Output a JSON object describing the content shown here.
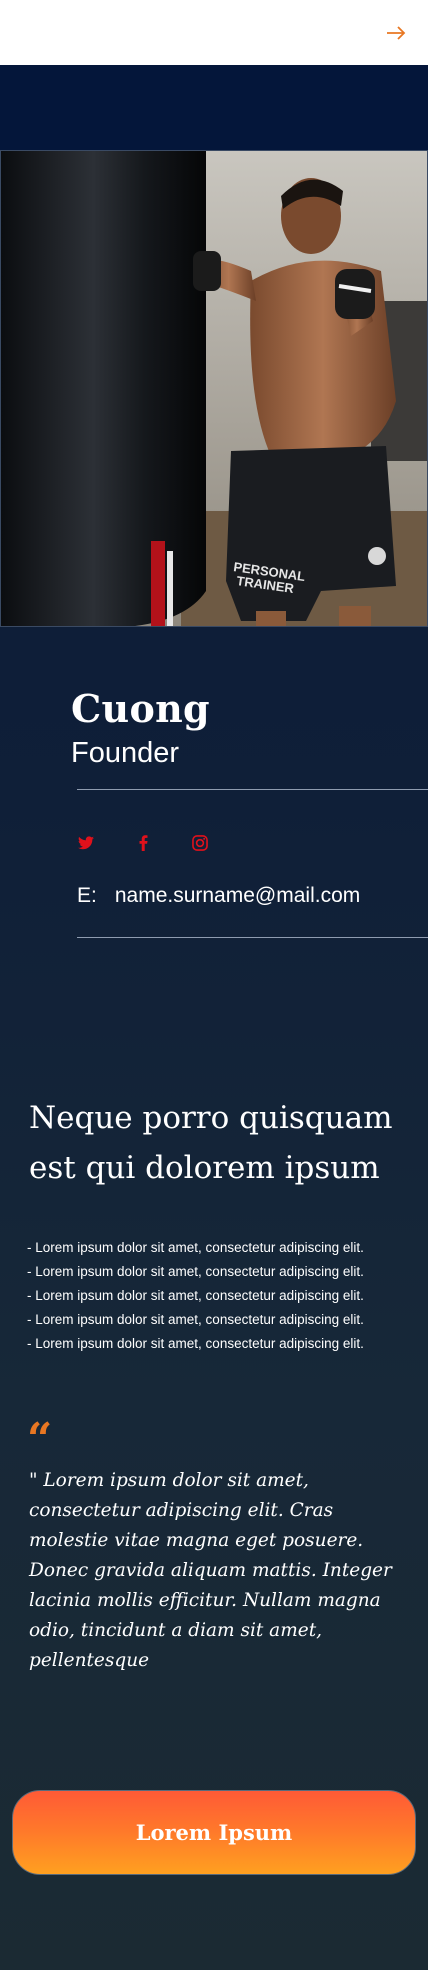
{
  "header": {
    "next_icon": "arrow-right-icon"
  },
  "profile": {
    "name": "Cuong",
    "role": "Founder",
    "email_label": "E:",
    "email": "name.surname@mail.com"
  },
  "social": {
    "twitter_icon": "twitter-icon",
    "facebook_icon": "facebook-icon",
    "instagram_icon": "instagram-icon"
  },
  "content": {
    "headline": "Neque porro quisquam est qui dolorem ipsum",
    "bullets": [
      "- Lorem ipsum dolor sit amet, consectetur adipiscing elit.",
      "- Lorem ipsum dolor sit amet, consectetur adipiscing elit.",
      "- Lorem ipsum dolor sit amet, consectetur adipiscing elit.",
      "- Lorem ipsum dolor sit amet, consectetur adipiscing elit.",
      "- Lorem ipsum dolor sit amet, consectetur adipiscing elit."
    ],
    "quote_mark": "“",
    "quote": "\" Lorem ipsum dolor sit amet, consectetur adipiscing elit. Cras molestie vitae magna eget posuere. Donec gravida aliquam mattis. Integer lacinia mollis efficitur. Nullam magna odio, tincidunt a diam sit amet, pellentesque"
  },
  "cta": {
    "label": "Lorem Ipsum"
  },
  "colors": {
    "accent": "#e87722",
    "social": "#e0111b",
    "navy": "#04163a"
  },
  "hero": {
    "shorts_text_1": "PERSONAL",
    "shorts_text_2": "TRAINER"
  }
}
